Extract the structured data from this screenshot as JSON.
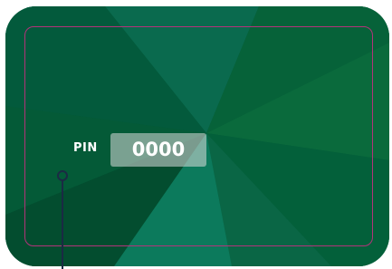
{
  "card": {
    "pin_label": "PIN",
    "pin_value": "0000"
  },
  "colors": {
    "card_base": "#03583a",
    "ray_light": "#0b7a5e",
    "ray_mid": "#0a6b4c",
    "ray_dark": "#02472e",
    "safe_area_border": "#b2337a",
    "marker": "#1b2a44",
    "pin_field_bg": "#c8d6cf",
    "text": "#ffffff"
  },
  "icons": {
    "marker": "anchor-pin-icon"
  }
}
